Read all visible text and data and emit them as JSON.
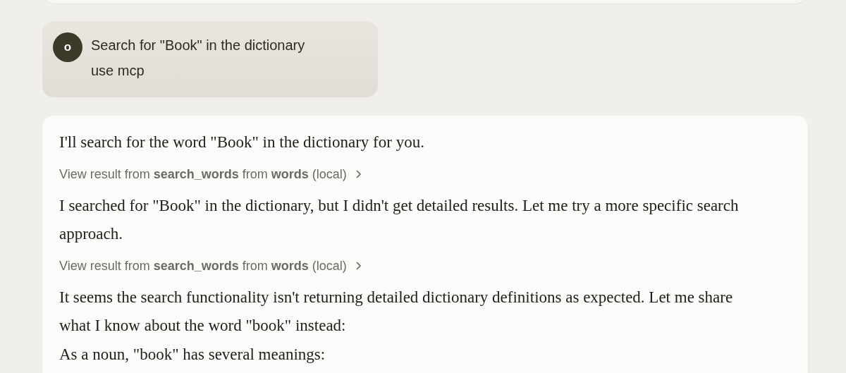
{
  "user_message": {
    "avatar": "o",
    "lines": [
      "Search for \"Book\" in the dictionary",
      "use mcp"
    ]
  },
  "assistant_message": {
    "blocks": [
      {
        "kind": "text",
        "text": "I'll search for the word \"Book\" in the dictionary for you."
      },
      {
        "kind": "tool",
        "text": "View result from **search_words** from **words** (local)"
      },
      {
        "kind": "text",
        "text": "I searched for \"Book\" in the dictionary, but I didn't get detailed results. Let me try a more specific search approach."
      },
      {
        "kind": "tool",
        "text": "View result from **search_words** from **words** (local)"
      },
      {
        "kind": "text",
        "text": "It seems the search functionality isn't returning detailed dictionary definitions as expected. Let me share what I know about the word \"book\" instead:"
      },
      {
        "kind": "text",
        "text": "As a noun, \"book\" has several meanings:"
      }
    ]
  }
}
